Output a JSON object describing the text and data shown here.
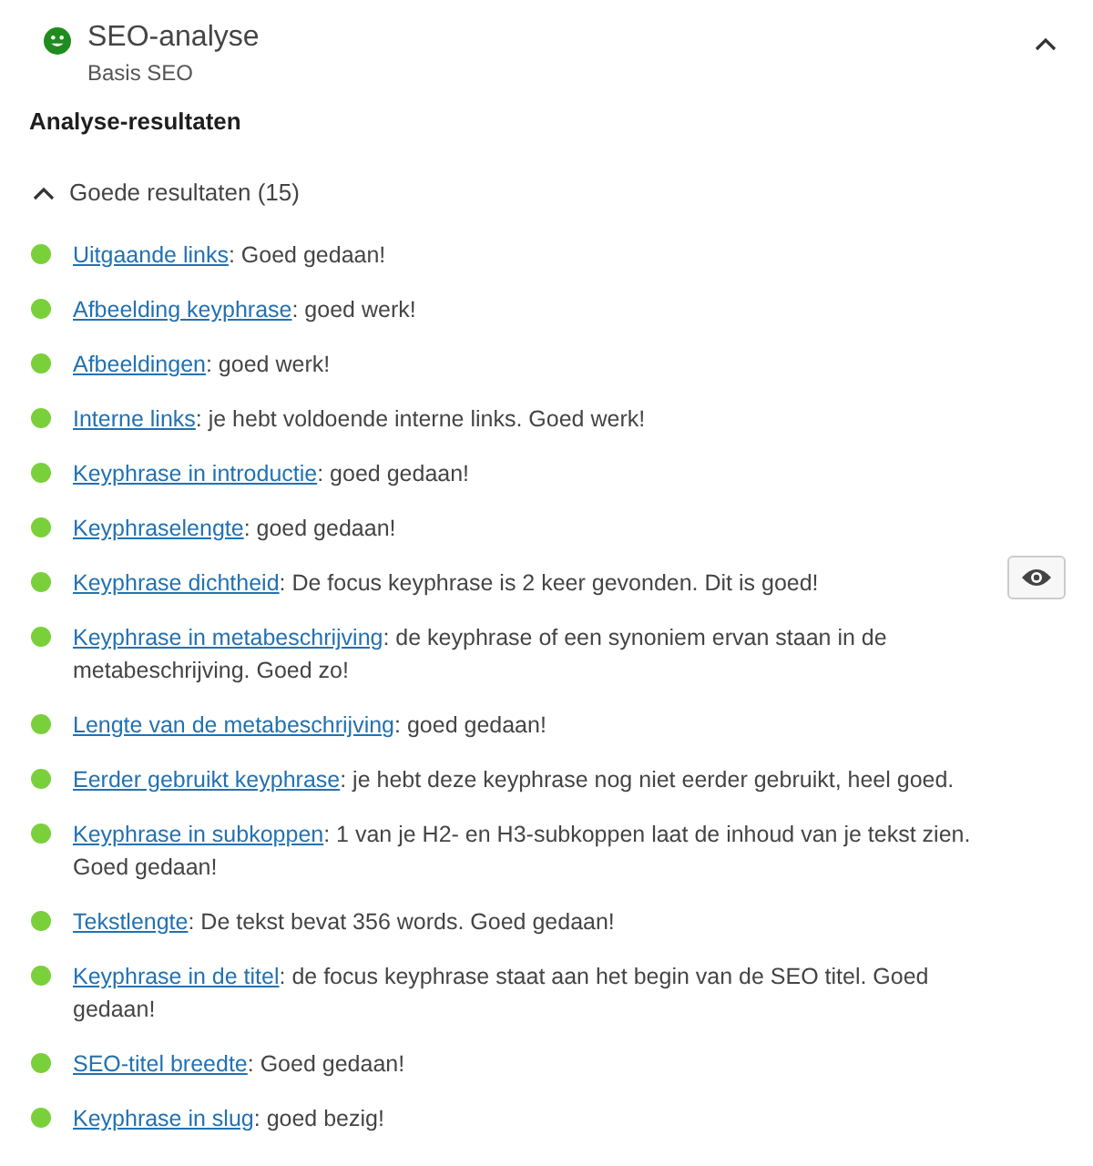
{
  "panel": {
    "title": "SEO-analyse",
    "subtitle": "Basis SEO",
    "expanded": true
  },
  "heading": "Analyse-resultaten",
  "section": {
    "label": "Goede resultaten (15)",
    "expanded": true
  },
  "results": [
    {
      "link": "Uitgaande links",
      "text": ": Goed gedaan!",
      "color": "#7ad03a",
      "marker_button": false
    },
    {
      "link": "Afbeelding keyphrase",
      "text": ": goed werk!",
      "color": "#7ad03a",
      "marker_button": false
    },
    {
      "link": "Afbeeldingen",
      "text": ": goed werk!",
      "color": "#7ad03a",
      "marker_button": false
    },
    {
      "link": "Interne links",
      "text": ": je hebt voldoende interne links. Goed werk!",
      "color": "#7ad03a",
      "marker_button": false
    },
    {
      "link": "Keyphrase in introductie",
      "text": ": goed gedaan!",
      "color": "#7ad03a",
      "marker_button": false
    },
    {
      "link": "Keyphraselengte",
      "text": ": goed gedaan!",
      "color": "#7ad03a",
      "marker_button": false
    },
    {
      "link": "Keyphrase dichtheid",
      "text": ": De focus keyphrase is 2 keer gevonden. Dit is goed!",
      "color": "#7ad03a",
      "marker_button": true
    },
    {
      "link": "Keyphrase in metabeschrijving",
      "text": ": de keyphrase of een synoniem ervan staan in de metabeschrijving. Goed zo!",
      "color": "#7ad03a",
      "marker_button": false
    },
    {
      "link": "Lengte van de metabeschrijving",
      "text": ": goed gedaan!",
      "color": "#7ad03a",
      "marker_button": false
    },
    {
      "link": "Eerder gebruikt keyphrase",
      "text": ": je hebt deze keyphrase nog niet eerder gebruikt, heel goed.",
      "color": "#7ad03a",
      "marker_button": false
    },
    {
      "link": "Keyphrase in subkoppen",
      "text": ": 1 van je H2- en H3-subkoppen laat de inhoud van je tekst zien. Goed gedaan!",
      "color": "#7ad03a",
      "marker_button": false
    },
    {
      "link": "Tekstlengte",
      "text": ": De tekst bevat 356 words. Goed gedaan!",
      "color": "#7ad03a",
      "marker_button": false
    },
    {
      "link": "Keyphrase in de titel",
      "text": ": de focus keyphrase staat aan het begin van de SEO titel. Goed gedaan!",
      "color": "#7ad03a",
      "marker_button": false
    },
    {
      "link": "SEO-titel breedte",
      "text": ": Goed gedaan!",
      "color": "#7ad03a",
      "marker_button": false
    },
    {
      "link": "Keyphrase in slug",
      "text": ": goed bezig!",
      "color": "#7ad03a",
      "marker_button": false
    }
  ]
}
